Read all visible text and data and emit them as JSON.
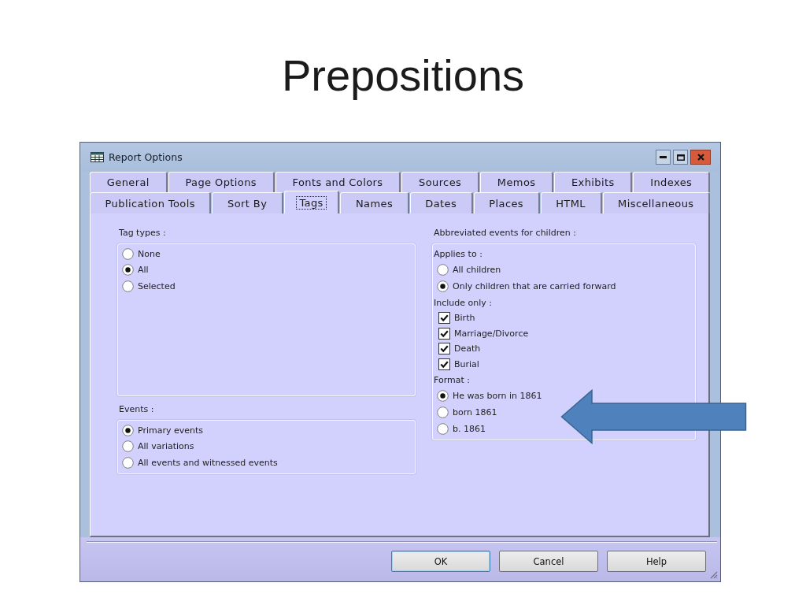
{
  "slide_title": "Prepositions",
  "window": {
    "title": "Report Options"
  },
  "tab_rows": [
    {
      "tabs": [
        {
          "label": "General",
          "selected": false
        },
        {
          "label": "Page Options",
          "selected": false
        },
        {
          "label": "Fonts and Colors",
          "selected": false
        },
        {
          "label": "Sources",
          "selected": false
        },
        {
          "label": "Memos",
          "selected": false
        },
        {
          "label": "Exhibits",
          "selected": false
        },
        {
          "label": "Indexes",
          "selected": false
        }
      ]
    },
    {
      "tabs": [
        {
          "label": "Publication Tools",
          "selected": false
        },
        {
          "label": "Sort By",
          "selected": false
        },
        {
          "label": "Tags",
          "selected": true
        },
        {
          "label": "Names",
          "selected": false
        },
        {
          "label": "Dates",
          "selected": false
        },
        {
          "label": "Places",
          "selected": false
        },
        {
          "label": "HTML",
          "selected": false
        },
        {
          "label": "Miscellaneous",
          "selected": false
        }
      ]
    }
  ],
  "tag_types": {
    "label": "Tag types :",
    "options": [
      {
        "label": "None",
        "selected": false
      },
      {
        "label": "All",
        "selected": true
      },
      {
        "label": "Selected",
        "selected": false
      }
    ]
  },
  "events": {
    "label": "Events :",
    "options": [
      {
        "label": "Primary events",
        "selected": true
      },
      {
        "label": "All variations",
        "selected": false
      },
      {
        "label": "All events and witnessed events",
        "selected": false
      }
    ]
  },
  "abbreviated_events": {
    "label": "Abbreviated events for children :",
    "sections": [
      {
        "kind": "radio",
        "label": "Applies to :",
        "options": [
          {
            "label": "All children",
            "selected": false
          },
          {
            "label": "Only children that are carried forward",
            "selected": true
          }
        ]
      },
      {
        "kind": "checkbox",
        "label": "Include only :",
        "options": [
          {
            "label": "Birth",
            "checked": true
          },
          {
            "label": "Marriage/Divorce",
            "checked": true
          },
          {
            "label": "Death",
            "checked": true
          },
          {
            "label": "Burial",
            "checked": true
          }
        ]
      },
      {
        "kind": "radio",
        "label": "Format :",
        "options": [
          {
            "label": "He was born in 1861",
            "selected": true
          },
          {
            "label": "born 1861",
            "selected": false
          },
          {
            "label": "b. 1861",
            "selected": false
          }
        ]
      }
    ]
  },
  "buttons": [
    {
      "label": "OK",
      "default": true
    },
    {
      "label": "Cancel",
      "default": false
    },
    {
      "label": "Help",
      "default": false
    }
  ]
}
